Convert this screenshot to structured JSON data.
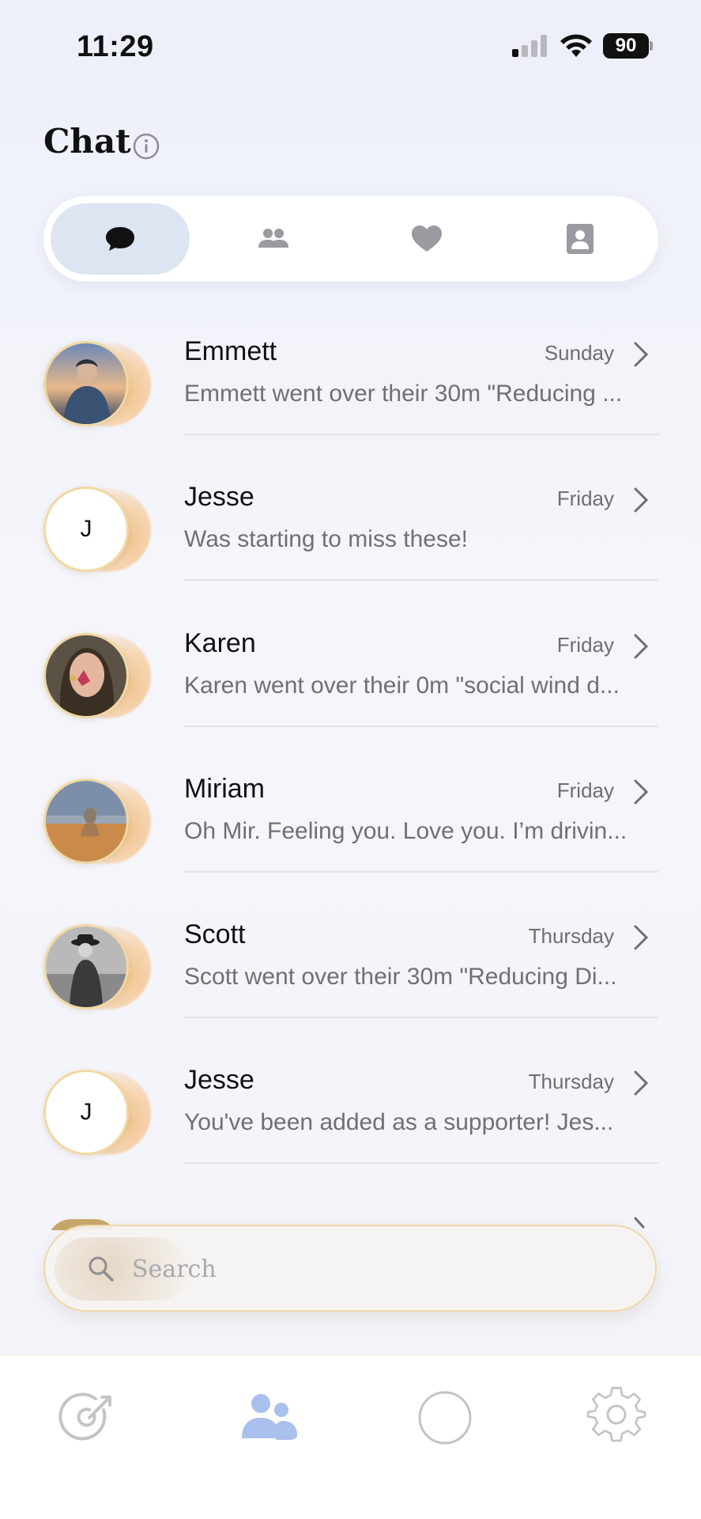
{
  "status_bar": {
    "time": "11:29",
    "battery": "90"
  },
  "header": {
    "title": "Chat"
  },
  "tabs": [
    {
      "name": "messages",
      "icon": "chat-bubble-icon",
      "active": true
    },
    {
      "name": "groups",
      "icon": "people-icon",
      "active": false
    },
    {
      "name": "favorites",
      "icon": "heart-icon",
      "active": false
    },
    {
      "name": "contacts",
      "icon": "contact-card-icon",
      "active": false
    }
  ],
  "chats": [
    {
      "name": "Emmett",
      "time": "Sunday",
      "preview": "Emmett went over their 30m \"Reducing ...",
      "avatar": "photo",
      "initial": ""
    },
    {
      "name": "Jesse",
      "time": "Friday",
      "preview": "Was starting to miss these!",
      "avatar": "initial",
      "initial": "J"
    },
    {
      "name": "Karen",
      "time": "Friday",
      "preview": "Karen went over their 0m \"social wind d...",
      "avatar": "photo",
      "initial": ""
    },
    {
      "name": "Miriam",
      "time": "Friday",
      "preview": "Oh Mir. Feeling you. Love you. I’m drivin...",
      "avatar": "photo",
      "initial": ""
    },
    {
      "name": "Scott",
      "time": "Thursday",
      "preview": "Scott went over their 30m \"Reducing Di...",
      "avatar": "photo",
      "initial": ""
    },
    {
      "name": "Jesse",
      "time": "Thursday",
      "preview": "You've been added as a supporter! Jes...",
      "avatar": "initial",
      "initial": "J"
    }
  ],
  "search": {
    "placeholder": "Search"
  },
  "bottom_nav": [
    {
      "name": "goals",
      "icon": "target-arrow-icon",
      "active": false
    },
    {
      "name": "community",
      "icon": "people-icon",
      "active": true
    },
    {
      "name": "focus",
      "icon": "circle-icon",
      "active": false
    },
    {
      "name": "settings",
      "icon": "gear-icon",
      "active": false
    }
  ],
  "colors": {
    "accent": "#a9c0ec",
    "active_tab_bg": "#dde4f2",
    "avatar_ring": "#f1d9a2",
    "muted_text": "#707074"
  }
}
